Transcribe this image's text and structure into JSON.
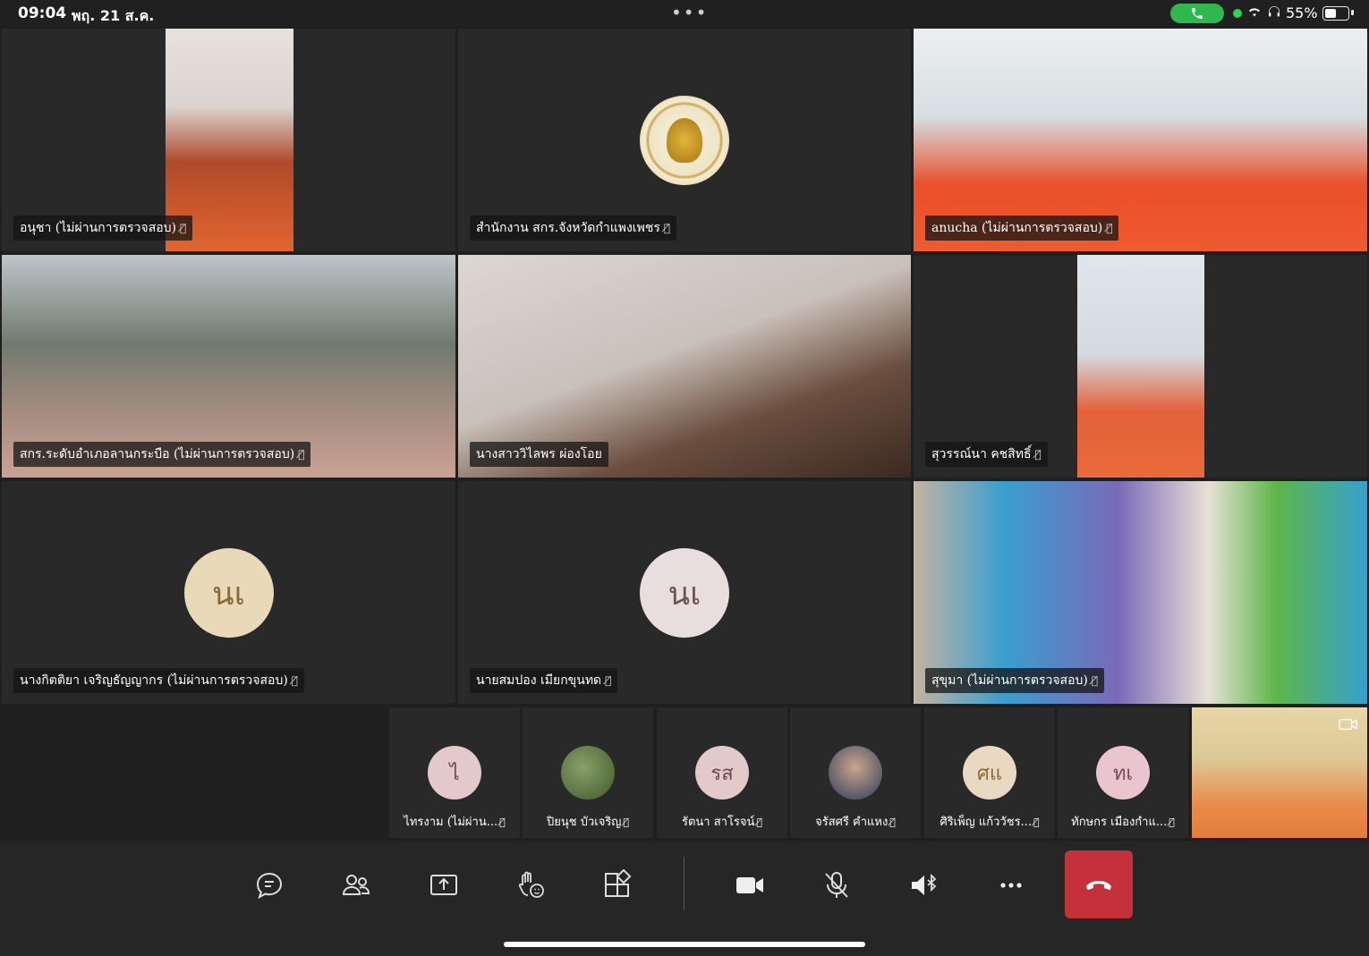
{
  "status_bar": {
    "time": "09:04",
    "date": "พฤ. 21 ส.ค.",
    "battery": "55%",
    "call_active_color": "#2fb84f"
  },
  "tiles": [
    {
      "name": "อนุชา (ไม่ผ่านการตรวจสอบ)",
      "type": "video",
      "muted": true
    },
    {
      "name": "สำนักงาน สกร.จังหวัดกำแพงเพชร",
      "type": "logo",
      "muted": true
    },
    {
      "name": "anucha (ไม่ผ่านการตรวจสอบ)",
      "type": "video",
      "muted": true
    },
    {
      "name": "สกร.ระดับอำเภอลานกระบือ (ไม่ผ่านการตรวจสอบ)",
      "type": "video",
      "muted": true
    },
    {
      "name": "นางสาววิไลพร  ผ่องโอย",
      "type": "video",
      "muted": false,
      "speaking": true
    },
    {
      "name": "สุวรรณ์นา คชสิทธิ์",
      "type": "video",
      "muted": true
    },
    {
      "name": "นางกิตติยา เจริญธัญญากร (ไม่ผ่านการตรวจสอบ)",
      "type": "avatar",
      "initials": "นเ",
      "muted": true
    },
    {
      "name": "นายสมปอง  เมียกขุนทด",
      "type": "avatar",
      "initials": "นเ",
      "muted": true
    },
    {
      "name": "สุขุมา (ไม่ผ่านการตรวจสอบ)",
      "type": "video",
      "muted": true
    }
  ],
  "strip": [
    {
      "name": "ไทรงาม (ไม่ผ่าน...",
      "initials": "ไ",
      "avatar_color": "#e3c9c9"
    },
    {
      "name": "ปิยนุช  บัวเจริญ",
      "initials": "",
      "avatar_color": "#5d7a3e"
    },
    {
      "name": "รัตนา  สาโรจน์",
      "initials": "รส",
      "avatar_color": "#e3c9c9"
    },
    {
      "name": "จรัสศรี คำแหง",
      "initials": "",
      "avatar_color": "#3a4a6a"
    },
    {
      "name": "ศิริเพ็ญ แก้ววัชร...",
      "initials": "ศแ",
      "avatar_color": "#ead9c2"
    },
    {
      "name": "ทักษกร เมืองกำแ...",
      "initials": "ทเ",
      "avatar_color": "#e8c5cf"
    }
  ],
  "controls": {
    "chat_icon": "chat-icon",
    "people_icon": "people-icon",
    "share_icon": "share-icon",
    "react_icon": "raise-hand-icon",
    "apps_icon": "apps-icon",
    "camera_icon": "camera-icon",
    "mic_icon": "mic-off-icon",
    "speaker_icon": "speaker-bluetooth-icon",
    "more_icon": "more-icon",
    "hangup_icon": "hangup-icon",
    "hangup_color": "#c4313b"
  },
  "avatar_bg": "#ead9b8",
  "avatar_text_color": "#8a6a3a"
}
